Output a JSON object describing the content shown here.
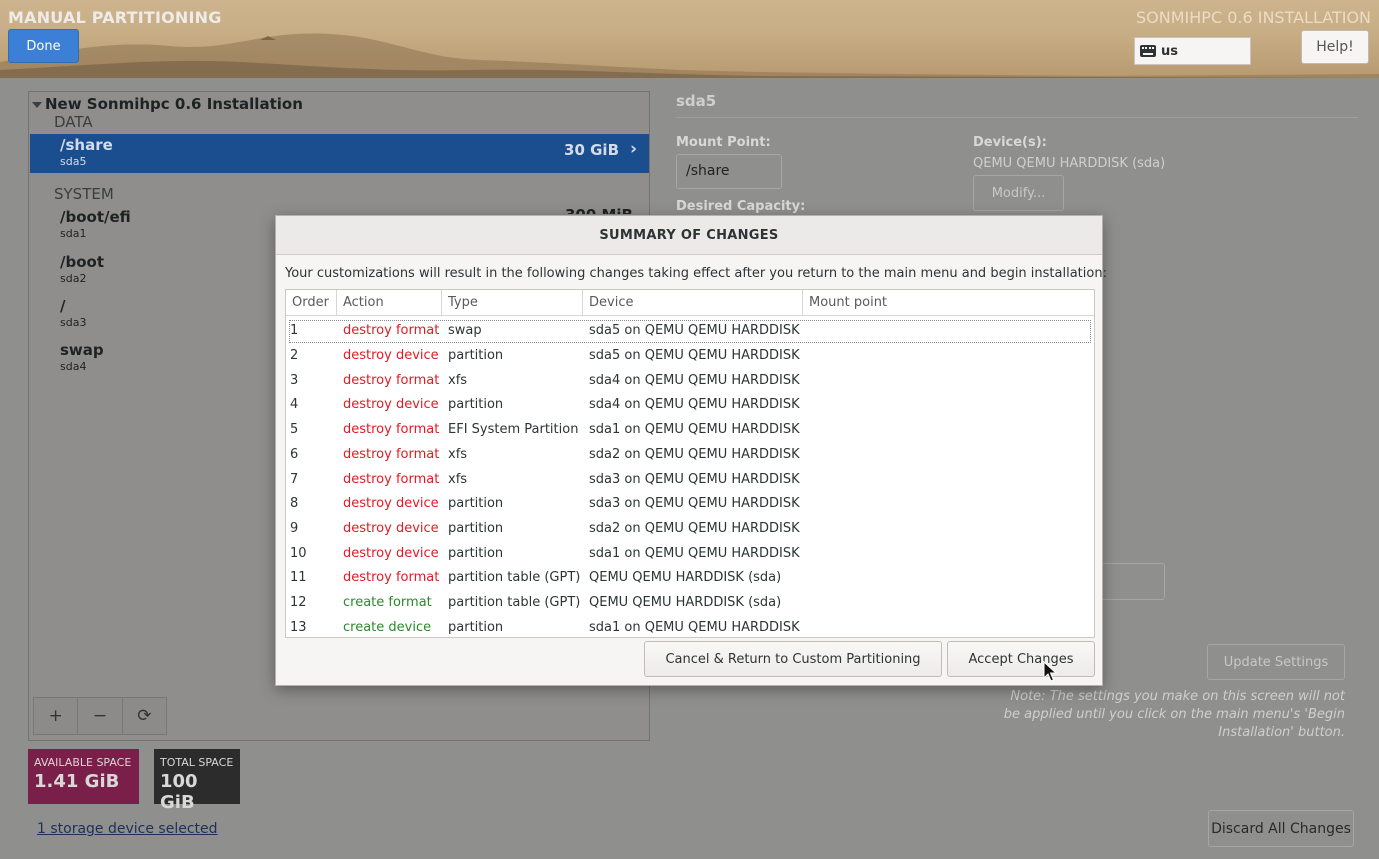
{
  "header": {
    "title": "MANUAL PARTITIONING",
    "done_label": "Done",
    "product_title": "SONMIHPC 0.6 INSTALLATION",
    "keyboard_layout": "us",
    "help_label": "Help!"
  },
  "left_panel": {
    "root_label": "New Sonmihpc 0.6 Installation",
    "groups": {
      "data": "DATA",
      "system": "SYSTEM"
    },
    "partitions": [
      {
        "name": "/share",
        "device": "sda5",
        "size": "30 GiB",
        "selected": true
      },
      {
        "name": "/boot/efi",
        "device": "sda1",
        "size": "300 MiB"
      },
      {
        "name": "/boot",
        "device": "sda2"
      },
      {
        "name": "/",
        "device": "sda3"
      },
      {
        "name": "swap",
        "device": "sda4"
      }
    ],
    "toolbar": {
      "add": "+",
      "remove": "−",
      "refresh": "⟳"
    },
    "available_space": {
      "label": "AVAILABLE SPACE",
      "value": "1.41 GiB"
    },
    "total_space": {
      "label": "TOTAL SPACE",
      "value": "100 GiB"
    },
    "storage_link": "1 storage device selected"
  },
  "right_panel": {
    "title": "sda5",
    "mount_point_label": "Mount Point:",
    "mount_point_value": "/share",
    "desired_capacity_label": "Desired Capacity:",
    "devices_label": "Device(s):",
    "devices_value": "QEMU QEMU HARDDISK (sda)",
    "modify_label": "Modify...",
    "update_settings_label": "Update Settings",
    "note": "Note:  The settings you make on this screen will not be applied until you click on the main menu's 'Begin Installation' button.",
    "discard_label": "Discard All Changes"
  },
  "dialog": {
    "title": "SUMMARY OF CHANGES",
    "description": "Your customizations will result in the following changes taking effect after you return to the main menu and begin installation:",
    "columns": [
      "Order",
      "Action",
      "Type",
      "Device",
      "Mount point"
    ],
    "rows": [
      {
        "order": "1",
        "action": "destroy format",
        "type": "swap",
        "device": "sda5 on QEMU QEMU HARDDISK",
        "mount": "",
        "kind": "destroy"
      },
      {
        "order": "2",
        "action": "destroy device",
        "type": "partition",
        "device": "sda5 on QEMU QEMU HARDDISK",
        "mount": "",
        "kind": "destroy"
      },
      {
        "order": "3",
        "action": "destroy format",
        "type": "xfs",
        "device": "sda4 on QEMU QEMU HARDDISK",
        "mount": "",
        "kind": "destroy"
      },
      {
        "order": "4",
        "action": "destroy device",
        "type": "partition",
        "device": "sda4 on QEMU QEMU HARDDISK",
        "mount": "",
        "kind": "destroy"
      },
      {
        "order": "5",
        "action": "destroy format",
        "type": "EFI System Partition",
        "device": "sda1 on QEMU QEMU HARDDISK",
        "mount": "",
        "kind": "destroy"
      },
      {
        "order": "6",
        "action": "destroy format",
        "type": "xfs",
        "device": "sda2 on QEMU QEMU HARDDISK",
        "mount": "",
        "kind": "destroy"
      },
      {
        "order": "7",
        "action": "destroy format",
        "type": "xfs",
        "device": "sda3 on QEMU QEMU HARDDISK",
        "mount": "",
        "kind": "destroy"
      },
      {
        "order": "8",
        "action": "destroy device",
        "type": "partition",
        "device": "sda3 on QEMU QEMU HARDDISK",
        "mount": "",
        "kind": "destroy"
      },
      {
        "order": "9",
        "action": "destroy device",
        "type": "partition",
        "device": "sda2 on QEMU QEMU HARDDISK",
        "mount": "",
        "kind": "destroy"
      },
      {
        "order": "10",
        "action": "destroy device",
        "type": "partition",
        "device": "sda1 on QEMU QEMU HARDDISK",
        "mount": "",
        "kind": "destroy"
      },
      {
        "order": "11",
        "action": "destroy format",
        "type": "partition table (GPT)",
        "device": "QEMU QEMU HARDDISK (sda)",
        "mount": "",
        "kind": "destroy"
      },
      {
        "order": "12",
        "action": "create format",
        "type": "partition table (GPT)",
        "device": "QEMU QEMU HARDDISK (sda)",
        "mount": "",
        "kind": "create"
      },
      {
        "order": "13",
        "action": "create device",
        "type": "partition",
        "device": "sda1 on QEMU QEMU HARDDISK",
        "mount": "",
        "kind": "create"
      }
    ],
    "cancel_label": "Cancel & Return to Custom Partitioning",
    "accept_label": "Accept Changes"
  },
  "colors": {
    "destroy": "#e01b24",
    "create": "#2b8a2b",
    "accent": "#3b80d6",
    "available_space": "#7a1f49"
  }
}
